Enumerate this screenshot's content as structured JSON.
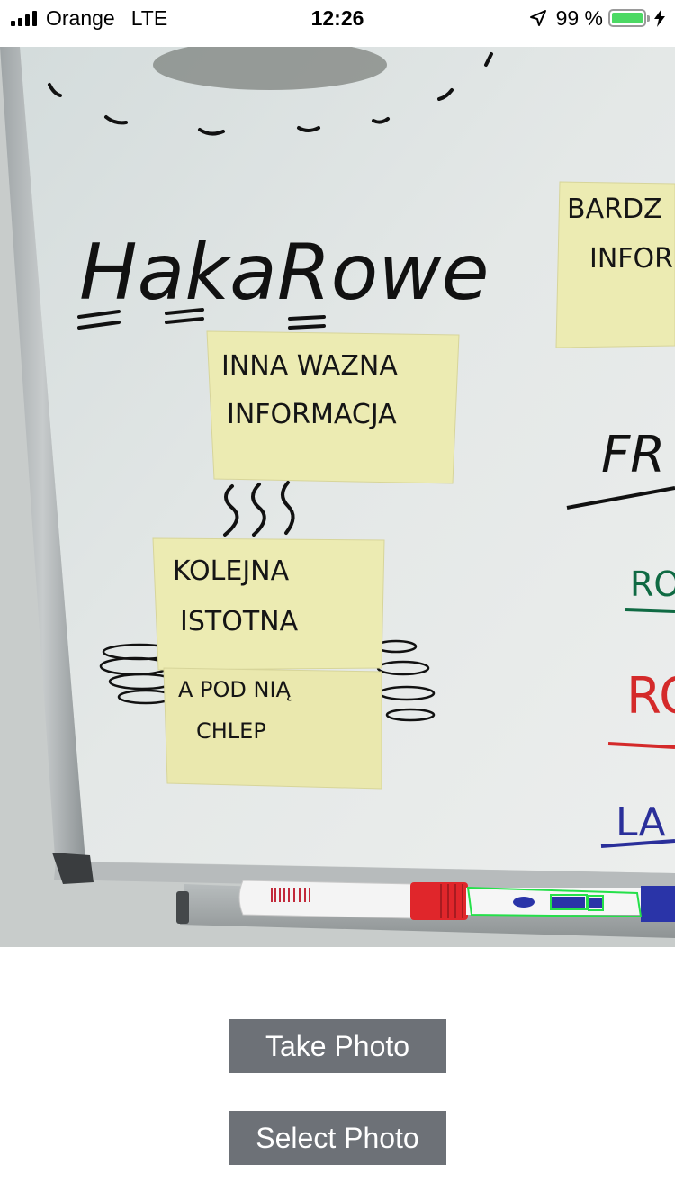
{
  "status_bar": {
    "carrier": "Orange",
    "network": "LTE",
    "time": "12:26",
    "battery_percent": "99 %",
    "battery_level": 0.99,
    "icons": [
      "signal-bars-icon",
      "location-arrow-icon",
      "battery-icon",
      "charging-bolt-icon"
    ]
  },
  "photo": {
    "board_heading": "HakaRowe",
    "notes": [
      {
        "lines": [
          "INNA WAZNA",
          "INFORMACJA"
        ]
      },
      {
        "lines": [
          "KOLEJNA",
          "ISTOTNA"
        ]
      },
      {
        "lines": [
          "A POD NIĄ",
          "CHLEP"
        ]
      },
      {
        "lines": [
          "BARDZ",
          "INFOR"
        ]
      }
    ],
    "edge_marks": [
      "FR",
      "RO",
      "RC",
      "LA"
    ],
    "colors": {
      "whiteboard": "#dde2e2",
      "sticky_note": "#ecebb2",
      "marker_black": "#111111",
      "marker_green": "#0f6a43",
      "marker_red": "#d42a2a",
      "marker_blue": "#2a2f9a",
      "detection_box": "#25e04a"
    }
  },
  "actions": {
    "take_photo_label": "Take Photo",
    "select_photo_label": "Select Photo"
  }
}
